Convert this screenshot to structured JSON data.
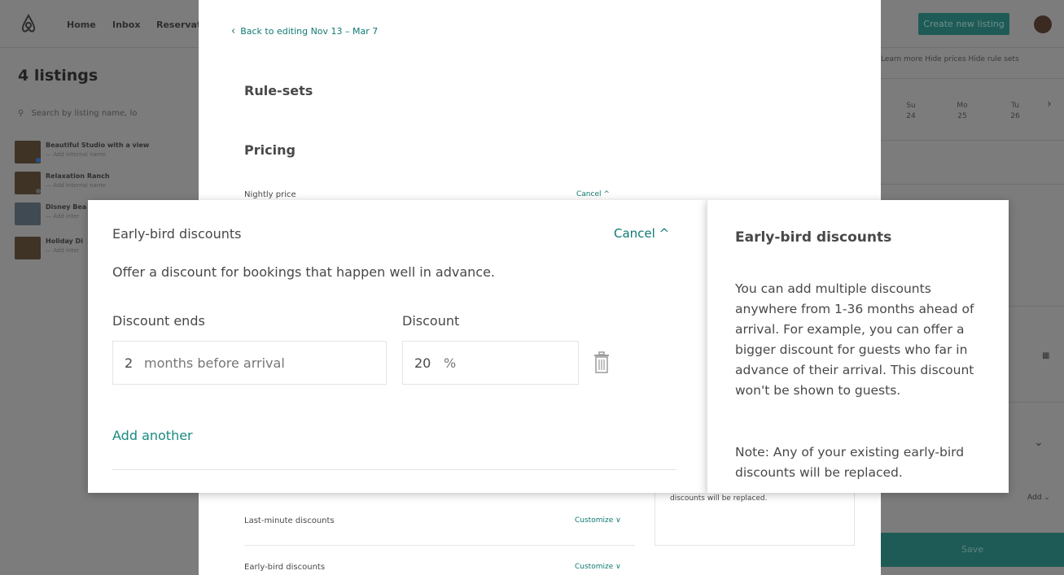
{
  "background": {
    "nav": {
      "home": "Home",
      "inbox": "Inbox",
      "reservations": "Reservat"
    },
    "create_listing": "Create new listing",
    "listings_title": "4 listings",
    "search_placeholder": "Search by listing name, lo",
    "listings": [
      {
        "name": "Beautiful Studio with a view",
        "sub": "— Add internal name"
      },
      {
        "name": "Relaxation Ranch",
        "sub": "— Add internal name"
      },
      {
        "name": "Disney Bea",
        "sub": "— Add inter"
      },
      {
        "name": "Holiday Di",
        "sub": "— Add inter"
      }
    ],
    "right_options": "Learn more    Hide prices    Hide rule sets",
    "calendar": [
      {
        "day": "Su",
        "date": "24"
      },
      {
        "day": "Mo",
        "date": "25"
      },
      {
        "day": "Tu",
        "date": "26"
      }
    ],
    "add_label": "Add",
    "save_label": "Save"
  },
  "drawer": {
    "back_link": "Back to editing Nov 13 – Mar 7",
    "ruleset_heading": "Rule-sets",
    "pricing_heading": "Pricing",
    "nightly_price": "Nightly price",
    "nightly_cancel": "Cancel ^",
    "side_note_tail": "discounts will be replaced.",
    "rows": [
      {
        "label": "Last-minute discounts",
        "action": "Customize ∨"
      },
      {
        "label": "Early-bird discounts",
        "action": "Customize ∨"
      }
    ]
  },
  "panel": {
    "title": "Early-bird discounts",
    "cancel": "Cancel ^",
    "description": "Offer a discount for bookings that happen well in advance.",
    "discount_ends_label": "Discount ends",
    "discount_label": "Discount",
    "ends_value": "2",
    "ends_suffix": "months before arrival",
    "discount_value": "20",
    "discount_suffix": "%",
    "add_another": "Add another"
  },
  "side_panel": {
    "title": "Early-bird discounts",
    "body": "You can add multiple discounts anywhere from 1-36 months ahead of arrival. For example, you can offer a bigger discount for guests who far in advance of their arrival. This discount won't be shown to guests.",
    "note": "Note: Any of your existing early-bird discounts will be replaced."
  }
}
